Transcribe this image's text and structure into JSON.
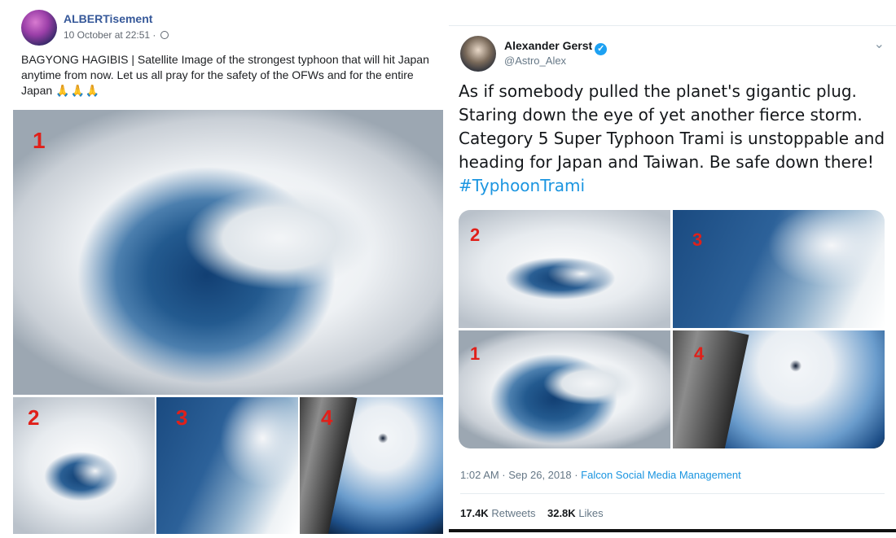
{
  "facebook_post": {
    "author": "ALBERTisement",
    "timestamp": "10 October at 22:51 ·",
    "privacy_icon": "globe-icon",
    "text": "BAGYONG HAGIBIS | Satellite Image of the strongest typhoon that will hit Japan anytime from now. Let us all pray for the safety of the OFWs and for the entire Japan",
    "emoji": "🙏🙏🙏",
    "image_labels": [
      "1",
      "2",
      "3",
      "4"
    ]
  },
  "tweet": {
    "author_name": "Alexander Gerst",
    "verified_icon": "verified-icon",
    "handle": "@Astro_Alex",
    "text": "As if somebody pulled the planet's gigantic plug. Staring down the eye of yet another fierce storm. Category 5 Super Typhoon Trami is unstoppable and heading for Japan and Taiwan. Be safe down there!",
    "hashtag": "#TyphoonTrami",
    "image_labels": [
      "2",
      "3",
      "1",
      "4"
    ],
    "timestamp": "1:02 AM · Sep 26, 2018 ·",
    "source": "Falcon Social Media Management",
    "retweets_count": "17.4K",
    "retweets_label": "Retweets",
    "likes_count": "32.8K",
    "likes_label": "Likes"
  },
  "colors": {
    "label_red": "#e0201a",
    "twitter_blue": "#1da1f2",
    "facebook_blue": "#365899"
  }
}
